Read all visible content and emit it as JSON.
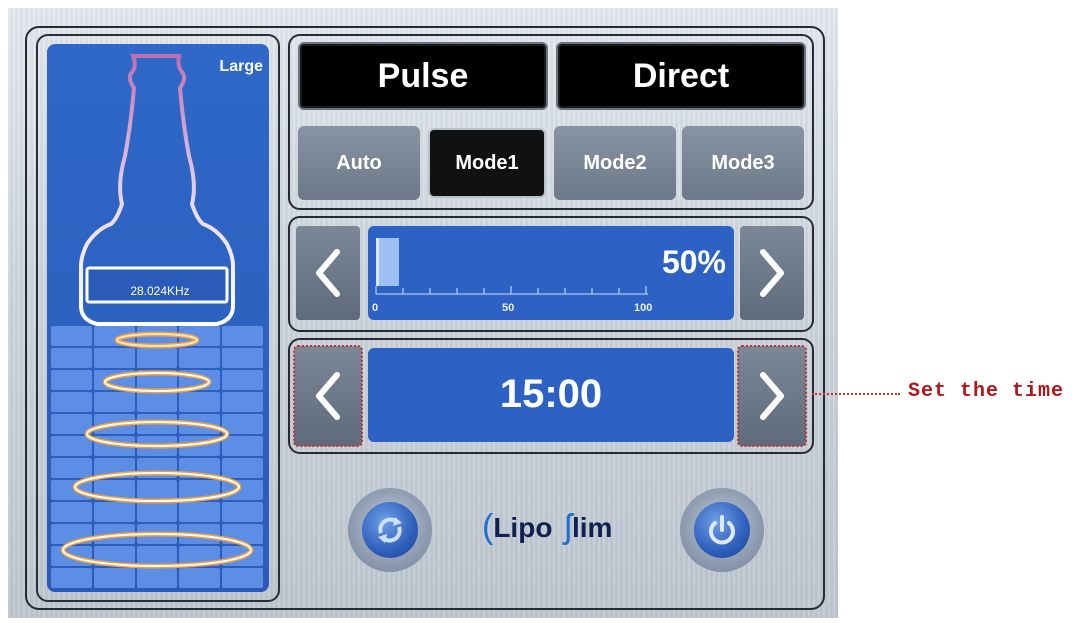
{
  "probe": {
    "size_label": "Large",
    "frequency": "28.024KHz"
  },
  "mode": {
    "primary_buttons": [
      "Pulse",
      "Direct"
    ],
    "sub_buttons": [
      "Auto",
      "Mode1",
      "Mode2",
      "Mode3"
    ],
    "selected_sub": "Mode1"
  },
  "intensity": {
    "value": 50,
    "display": "50%",
    "scale_labels": [
      "0",
      "50",
      "100"
    ]
  },
  "timer": {
    "display": "15:00"
  },
  "brand": {
    "part1": "Lipo",
    "part2": "lim"
  },
  "annotation": {
    "text": "Set the time"
  },
  "icons": {
    "prev": "chevron-left-icon",
    "next": "chevron-right-icon",
    "reset": "refresh-icon",
    "power": "power-icon"
  },
  "colors": {
    "panel_blue": "#2d62c4",
    "annotation_red": "#b1161b",
    "ring_orange": "#f0a040"
  }
}
